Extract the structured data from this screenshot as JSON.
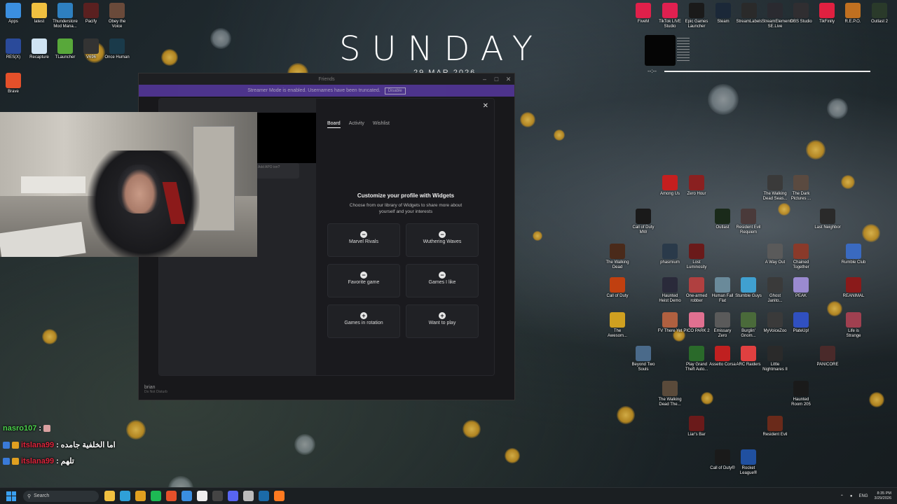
{
  "wallpaper_clock": {
    "day": "SUNDAY",
    "date": "29 MAR 2026"
  },
  "media_widget": {
    "time": "--:--"
  },
  "desktop_left": [
    {
      "label": "Apps",
      "color": "#3b8fe0"
    },
    {
      "label": "latest",
      "color": "#f0c040"
    },
    {
      "label": "Thunderstore Mod Mana...",
      "color": "#2e7fbf"
    },
    {
      "label": "Pacify",
      "color": "#5a2020"
    },
    {
      "label": "Obey the Voice",
      "color": "#6a4a3a"
    },
    {
      "label": "RES(X)",
      "color": "#2a4a9a"
    },
    {
      "label": "Recapture",
      "color": "#cfe3f2"
    },
    {
      "label": "TLauncher",
      "color": "#58a83a"
    },
    {
      "label": "V696",
      "color": "#333333"
    },
    {
      "label": "Once Human",
      "color": "#1a3a4a"
    },
    {
      "label": "Brave",
      "color": "#e4502a"
    }
  ],
  "desktop_top": [
    {
      "label": "FiveM",
      "color": "#e0204a"
    },
    {
      "label": "TikTok LIVE Studio",
      "color": "#e02050"
    },
    {
      "label": "Epic Games Launcher",
      "color": "#1a1a1a"
    },
    {
      "label": "Steam",
      "color": "#1b2838"
    },
    {
      "label": "StreamLabels",
      "color": "#2a2a2a"
    },
    {
      "label": "StreamElements SE.Live",
      "color": "#2a2a30"
    },
    {
      "label": "OBS Studio",
      "color": "#302e31"
    },
    {
      "label": "TikFinity",
      "color": "#e02040"
    },
    {
      "label": "R.E.P.O.",
      "color": "#c07020"
    },
    {
      "label": "Outlast 2",
      "color": "#2a3a2a"
    }
  ],
  "desktop_right": [
    {
      "label": "Among Us",
      "color": "#c51f1f"
    },
    {
      "label": "Zero Hour",
      "color": "#8a2020"
    },
    {
      "label": "The Walking Dead Seas...",
      "color": "#3a3a3a"
    },
    {
      "label": "The Dark Pictures ...",
      "color": "#5a4a40"
    },
    {
      "label": "Call of Duty MW",
      "color": "#1a1a1a"
    },
    {
      "label": "Outlast",
      "color": "#1a2a1a"
    },
    {
      "label": "Resident Evil Requiem",
      "color": "#4a3a3a"
    },
    {
      "label": "Last Neighbor",
      "color": "#2a2a2a"
    },
    {
      "label": "The Walking Dead",
      "color": "#4a2a1a"
    },
    {
      "label": "phasmium",
      "color": "#2a3a4a"
    },
    {
      "label": "Lost Luminosity",
      "color": "#6a1a1a"
    },
    {
      "label": "A Way Out",
      "color": "#5a5a5a"
    },
    {
      "label": "Chained Together",
      "color": "#8a3a2a"
    },
    {
      "label": "Rumble Club",
      "color": "#3a6ac0"
    },
    {
      "label": "Call of Duty",
      "color": "#c04010"
    },
    {
      "label": "Haunted Heist Demo",
      "color": "#2a2a3a"
    },
    {
      "label": "One-armed robber",
      "color": "#b04040"
    },
    {
      "label": "Human Fall Flat",
      "color": "#6a8a9a"
    },
    {
      "label": "Stumble Guys",
      "color": "#40a0d0"
    },
    {
      "label": "Ghost Janito...",
      "color": "#3a3a3a"
    },
    {
      "label": "PEAK",
      "color": "#9a8ad0"
    },
    {
      "label": "REANIMAL",
      "color": "#8a1a1a"
    },
    {
      "label": "The Awesom...",
      "color": "#d0a020"
    },
    {
      "label": "FV There Yet",
      "color": "#b06040"
    },
    {
      "label": "PICO PARK 2",
      "color": "#e07090"
    },
    {
      "label": "Emissary Zero",
      "color": "#5a5a5a"
    },
    {
      "label": "Burglin' Gnom...",
      "color": "#4a6a3a"
    },
    {
      "label": "MyVoiceZoo",
      "color": "#3a3a3a"
    },
    {
      "label": "PlateUp!",
      "color": "#3050c0"
    },
    {
      "label": "Life is Strange",
      "color": "#a04050"
    },
    {
      "label": "Beyond Two Souls",
      "color": "#4a6a8a"
    },
    {
      "label": "Play Grand Theft Auto...",
      "color": "#2a6a2a"
    },
    {
      "label": "Assetto Corsa",
      "color": "#c02020"
    },
    {
      "label": "ARC Raiders",
      "color": "#e04040"
    },
    {
      "label": "Little Nightmares II",
      "color": "#2a2a2a"
    },
    {
      "label": "PANICORE",
      "color": "#4a2a2a"
    },
    {
      "label": "The Walking Dead The...",
      "color": "#5a4a3a"
    },
    {
      "label": "Haunted Room 205",
      "color": "#1a1a1a"
    },
    {
      "label": "Liar's Bar",
      "color": "#6a1a1a"
    },
    {
      "label": "Resident Evil",
      "color": "#6a2a1a"
    },
    {
      "label": "Call of Duty®",
      "color": "#1a1a1a"
    },
    {
      "label": "Rocket League®",
      "color": "#2050a0"
    }
  ],
  "discord": {
    "title": "Friends",
    "notice": "Streamer Mode is enabled. Usernames have been truncated.",
    "notice_button": "Disable",
    "user_name": "brian",
    "user_status": "Do Not Disturb"
  },
  "modal": {
    "left_note": "Add APO ion?",
    "tabs": [
      {
        "label": "Board",
        "active": true
      },
      {
        "label": "Activity",
        "active": false
      },
      {
        "label": "Wishlist",
        "active": false
      }
    ],
    "title": "Customize your profile with Widgets",
    "subtitle": "Choose from our library of Widgets to share more about yourself and your interests",
    "widgets": [
      {
        "label": "Marvel Rivals",
        "icon": "minus"
      },
      {
        "label": "Wuthering Waves",
        "icon": "minus"
      },
      {
        "label": "Favorite game",
        "icon": "minus"
      },
      {
        "label": "Games I like",
        "icon": "minus"
      },
      {
        "label": "Games in rotation",
        "icon": "plus"
      },
      {
        "label": "Want to play",
        "icon": "plus"
      }
    ]
  },
  "chat": [
    {
      "user": "nasro107",
      "message": "",
      "user_color": "#4cd34c"
    },
    {
      "user": "itslana99",
      "message": "اما الخلفية جامده",
      "user_color": "#e0243c"
    },
    {
      "user": "itslana99",
      "message": "تلهم",
      "user_color": "#e0243c"
    }
  ],
  "taskbar": {
    "search_placeholder": "Search",
    "language": "ENG",
    "time": "8:35 PM",
    "date": "3/29/2026",
    "pinned": [
      {
        "name": "file-explorer-icon",
        "color": "#f0c040"
      },
      {
        "name": "edge-icon",
        "color": "#2fa0d8"
      },
      {
        "name": "chrome-icon",
        "color": "#e0a020"
      },
      {
        "name": "spotify-icon",
        "color": "#1db954"
      },
      {
        "name": "brave-icon",
        "color": "#e4502a"
      },
      {
        "name": "store-icon",
        "color": "#3a8ee0"
      },
      {
        "name": "capcut-icon",
        "color": "#eeeeee"
      },
      {
        "name": "terminal-icon",
        "color": "#444444"
      },
      {
        "name": "discord-icon",
        "color": "#5865f2"
      },
      {
        "name": "obs-icon",
        "color": "#bbbbbb"
      },
      {
        "name": "steam-icon",
        "color": "#1b6aa8"
      },
      {
        "name": "firefox-icon",
        "color": "#ff7a20"
      }
    ]
  }
}
